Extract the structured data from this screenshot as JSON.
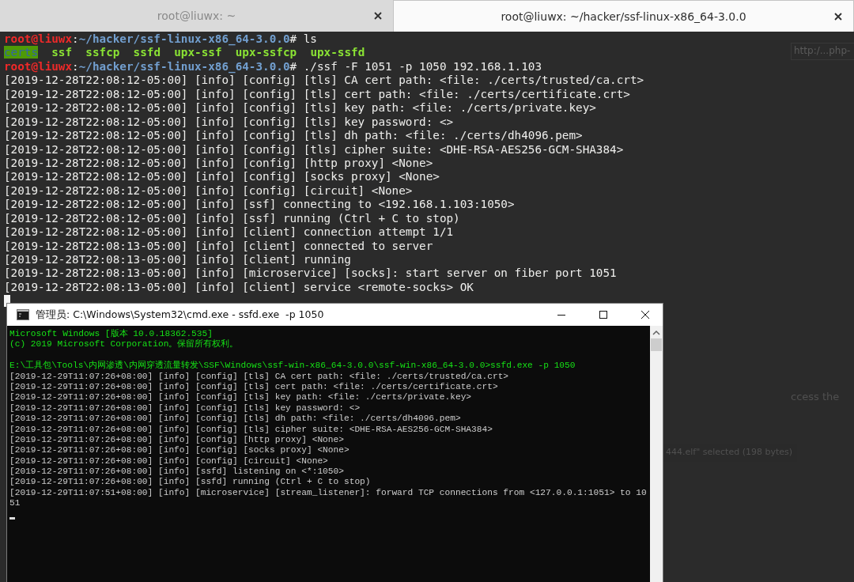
{
  "terminal_tabs": [
    {
      "label": "root@liuwx: ~",
      "selected": false
    },
    {
      "label": "root@liuwx: ~/hacker/ssf-linux-x86_64-3.0.0",
      "selected": true
    }
  ],
  "background_window": {
    "address": "http:/...php-",
    "text": "ccess the",
    "status": "444.elf\" selected  (198 bytes)"
  },
  "terminal": {
    "lines": [
      {
        "kind": "prompt",
        "segments": [
          {
            "text": "root@liuwx",
            "kind": "user"
          },
          {
            "text": ":",
            "kind": "plain"
          },
          {
            "text": "~/hacker/ssf-linux-x86_64-3.0.0",
            "kind": "path"
          },
          {
            "text": "# ls",
            "kind": "plain"
          }
        ]
      },
      {
        "kind": "listing",
        "entries": [
          {
            "name": "certs",
            "kind": "dir"
          },
          {
            "name": "ssf",
            "kind": "exec"
          },
          {
            "name": "ssfcp",
            "kind": "exec"
          },
          {
            "name": "ssfd",
            "kind": "exec"
          },
          {
            "name": "upx-ssf",
            "kind": "exec"
          },
          {
            "name": "upx-ssfcp",
            "kind": "exec"
          },
          {
            "name": "upx-ssfd",
            "kind": "exec"
          }
        ]
      },
      {
        "kind": "prompt",
        "segments": [
          {
            "text": "root@liuwx",
            "kind": "user"
          },
          {
            "text": ":",
            "kind": "plain"
          },
          {
            "text": "~/hacker/ssf-linux-x86_64-3.0.0",
            "kind": "path"
          },
          {
            "text": "# ./ssf -F 1051 -p 1050 192.168.1.103",
            "kind": "plain"
          }
        ]
      },
      {
        "kind": "log",
        "text": "[2019-12-28T22:08:12-05:00] [info] [config] [tls] CA cert path: <file: ./certs/trusted/ca.crt>"
      },
      {
        "kind": "log",
        "text": "[2019-12-28T22:08:12-05:00] [info] [config] [tls] cert path: <file: ./certs/certificate.crt>"
      },
      {
        "kind": "log",
        "text": "[2019-12-28T22:08:12-05:00] [info] [config] [tls] key path: <file: ./certs/private.key>"
      },
      {
        "kind": "log",
        "text": "[2019-12-28T22:08:12-05:00] [info] [config] [tls] key password: <>"
      },
      {
        "kind": "log",
        "text": "[2019-12-28T22:08:12-05:00] [info] [config] [tls] dh path: <file: ./certs/dh4096.pem>"
      },
      {
        "kind": "log",
        "text": "[2019-12-28T22:08:12-05:00] [info] [config] [tls] cipher suite: <DHE-RSA-AES256-GCM-SHA384>"
      },
      {
        "kind": "log",
        "text": "[2019-12-28T22:08:12-05:00] [info] [config] [http proxy] <None>"
      },
      {
        "kind": "log",
        "text": "[2019-12-28T22:08:12-05:00] [info] [config] [socks proxy] <None>"
      },
      {
        "kind": "log",
        "text": "[2019-12-28T22:08:12-05:00] [info] [config] [circuit] <None>"
      },
      {
        "kind": "log",
        "text": "[2019-12-28T22:08:12-05:00] [info] [ssf] connecting to <192.168.1.103:1050>"
      },
      {
        "kind": "log",
        "text": "[2019-12-28T22:08:12-05:00] [info] [ssf] running (Ctrl + C to stop)"
      },
      {
        "kind": "log",
        "text": "[2019-12-28T22:08:12-05:00] [info] [client] connection attempt 1/1"
      },
      {
        "kind": "log",
        "text": "[2019-12-28T22:08:13-05:00] [info] [client] connected to server"
      },
      {
        "kind": "log",
        "text": "[2019-12-28T22:08:13-05:00] [info] [client] running"
      },
      {
        "kind": "log",
        "text": "[2019-12-28T22:08:13-05:00] [info] [microservice] [socks]: start server on fiber port 1051"
      },
      {
        "kind": "log",
        "text": "[2019-12-28T22:08:13-05:00] [info] [client] service <remote-socks> OK"
      }
    ]
  },
  "cmd_window": {
    "title": "管理员: C:\\Windows\\System32\\cmd.exe - ssfd.exe  -p 1050",
    "lines": [
      {
        "kind": "banner",
        "text": "Microsoft Windows [版本 10.0.18362.535]"
      },
      {
        "kind": "banner",
        "text": "(c) 2019 Microsoft Corporation。保留所有权利。"
      },
      {
        "kind": "blank"
      },
      {
        "kind": "banner",
        "text": "E:\\工具包\\Tools\\内网渗透\\内网穿透流量转发\\SSF\\Windows\\ssf-win-x86_64-3.0.0\\ssf-win-x86_64-3.0.0>ssfd.exe -p 1050"
      },
      {
        "kind": "log",
        "text": "[2019-12-29T11:07:26+08:00] [info] [config] [tls] CA cert path: <file: ./certs/trusted/ca.crt>"
      },
      {
        "kind": "log",
        "text": "[2019-12-29T11:07:26+08:00] [info] [config] [tls] cert path: <file: ./certs/certificate.crt>"
      },
      {
        "kind": "log",
        "text": "[2019-12-29T11:07:26+08:00] [info] [config] [tls] key path: <file: ./certs/private.key>"
      },
      {
        "kind": "log",
        "text": "[2019-12-29T11:07:26+08:00] [info] [config] [tls] key password: <>"
      },
      {
        "kind": "log",
        "text": "[2019-12-29T11:07:26+08:00] [info] [config] [tls] dh path: <file: ./certs/dh4096.pem>"
      },
      {
        "kind": "log",
        "text": "[2019-12-29T11:07:26+08:00] [info] [config] [tls] cipher suite: <DHE-RSA-AES256-GCM-SHA384>"
      },
      {
        "kind": "log",
        "text": "[2019-12-29T11:07:26+08:00] [info] [config] [http proxy] <None>"
      },
      {
        "kind": "log",
        "text": "[2019-12-29T11:07:26+08:00] [info] [config] [socks proxy] <None>"
      },
      {
        "kind": "log",
        "text": "[2019-12-29T11:07:26+08:00] [info] [config] [circuit] <None>"
      },
      {
        "kind": "log",
        "text": "[2019-12-29T11:07:26+08:00] [info] [ssfd] listening on <*:1050>"
      },
      {
        "kind": "log",
        "text": "[2019-12-29T11:07:26+08:00] [info] [ssfd] running (Ctrl + C to stop)"
      },
      {
        "kind": "log",
        "text": "[2019-12-29T11:07:51+08:00] [info] [microservice] [stream_listener]: forward TCP connections from <127.0.0.1:1051> to 10"
      },
      {
        "kind": "log",
        "text": "51"
      }
    ]
  }
}
